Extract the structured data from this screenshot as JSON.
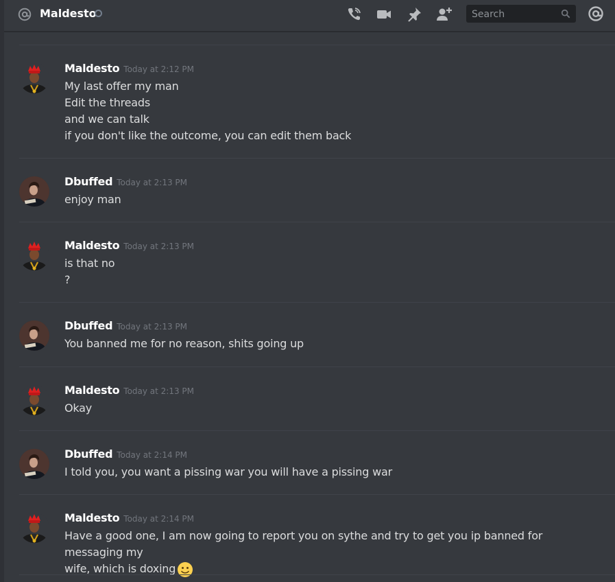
{
  "header": {
    "channel_name": "Maldesto",
    "icons": [
      "at-icon",
      "call-icon",
      "video-icon",
      "pin-icon",
      "add-friend-icon",
      "mention-icon"
    ],
    "search_placeholder": "Search"
  },
  "messages": [
    {
      "author": "Maldesto",
      "timestamp": "Today at 2:12 PM",
      "lines": [
        "My last offer my man",
        "Edit the threads",
        "and we can talk",
        "if you don't like the outcome, you can edit them back"
      ]
    },
    {
      "author": "Dbuffed",
      "timestamp": "Today at 2:13 PM",
      "lines": [
        "enjoy man"
      ]
    },
    {
      "author": "Maldesto",
      "timestamp": "Today at 2:13 PM",
      "lines": [
        "is that no",
        "?"
      ]
    },
    {
      "author": "Dbuffed",
      "timestamp": "Today at 2:13 PM",
      "lines": [
        "You banned me for no reason, shits going up"
      ]
    },
    {
      "author": "Maldesto",
      "timestamp": "Today at 2:13 PM",
      "lines": [
        "Okay"
      ]
    },
    {
      "author": "Dbuffed",
      "timestamp": "Today at 2:14 PM",
      "lines": [
        "I told you, you want a pissing war you will have a pissing war"
      ]
    },
    {
      "author": "Maldesto",
      "timestamp": "Today at 2:14 PM",
      "lines": [
        "Have a good one, I am now going to report you on sythe and try to get you ip banned for messaging my",
        "wife, which is doxing"
      ],
      "trailing_emoji": "slightly-smiling-face-emoji"
    }
  ]
}
